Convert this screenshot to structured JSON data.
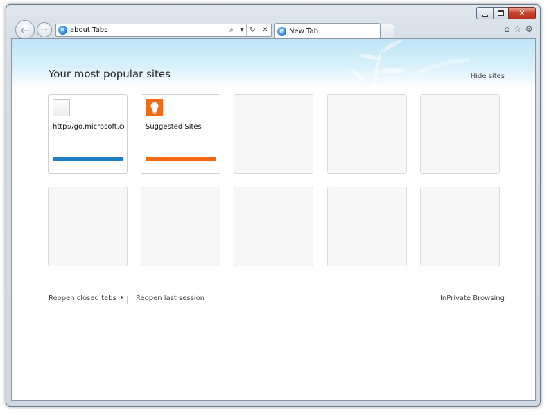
{
  "window": {
    "close_glyph": "✕"
  },
  "nav": {
    "back_glyph": "←",
    "forward_glyph": "→"
  },
  "address_bar": {
    "url": "about:Tabs",
    "search_glyph": "⌕",
    "dropdown_glyph": "▾",
    "refresh_glyph": "↻",
    "stop_glyph": "✕"
  },
  "tabs": [
    {
      "title": "New Tab"
    }
  ],
  "commands": {
    "home_glyph": "⌂",
    "favorites_glyph": "☆",
    "tools_glyph": "⚙"
  },
  "page": {
    "title": "Your most popular sites",
    "hide_sites": "Hide sites",
    "tiles": [
      {
        "label": "http://go.microsoft.cor",
        "icon": "blank-page-icon",
        "bar_color": "#1e7fc7"
      },
      {
        "label": "Suggested Sites",
        "icon": "lightbulb-icon",
        "bar_color": "#f26b14"
      }
    ],
    "footer": {
      "reopen_closed_tabs": "Reopen closed tabs",
      "reopen_last_session": "Reopen last session",
      "inprivate": "InPrivate Browsing"
    }
  },
  "colors": {
    "accent_blue": "#1e7fc7",
    "accent_orange": "#f26b14",
    "close_red": "#c7402b"
  }
}
